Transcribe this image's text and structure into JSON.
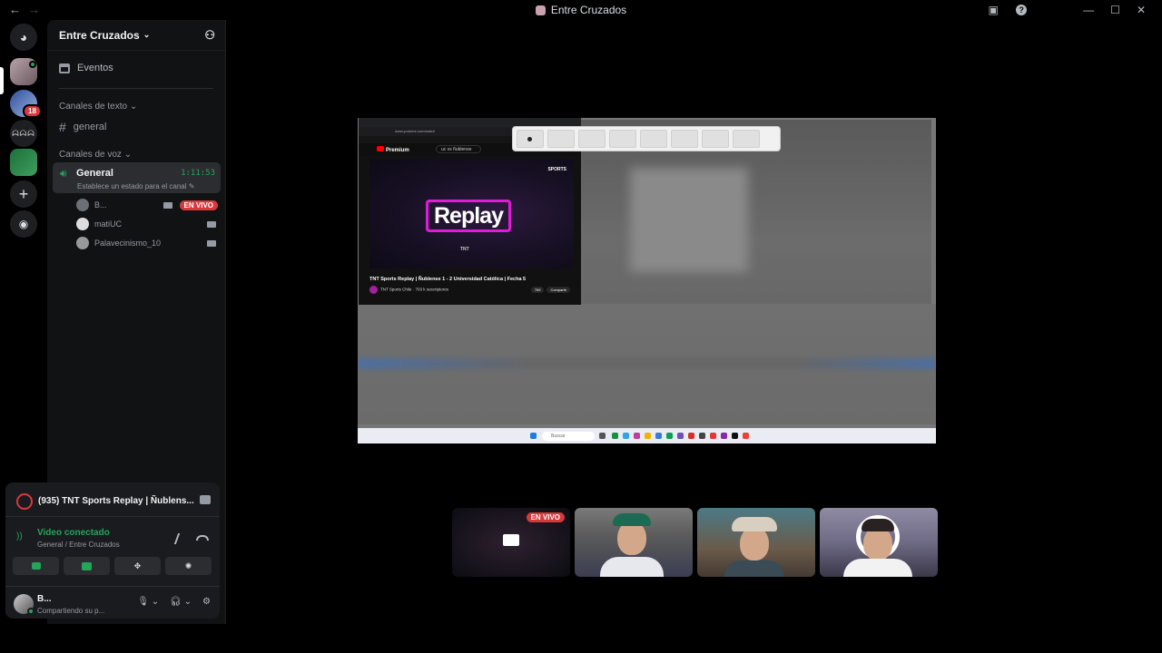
{
  "window": {
    "title": "Entre Cruzados",
    "back_icon": "←",
    "forward_icon": "→",
    "minimize": "—",
    "maximize": "☐",
    "close": "✕"
  },
  "guilds": {
    "badge": "18",
    "g3_label": "ᗣᗣᗣ"
  },
  "server": {
    "name": "Entre Cruzados",
    "events_label": "Eventos",
    "text_category": "Canales de texto",
    "text_channels": [
      {
        "name": "general"
      }
    ],
    "voice_category": "Canales de voz",
    "voice_channel": {
      "name": "General",
      "timer": "1:11:53",
      "status_placeholder": "Establece un estado para el canal"
    },
    "voice_users": [
      {
        "name": "B...",
        "live_label": "EN VIVO"
      },
      {
        "name": "matiUC"
      },
      {
        "name": "Palavecinismo_10"
      }
    ]
  },
  "stream_panel": {
    "title": "(935) TNT Sports Replay | Ñublens..."
  },
  "rtc": {
    "status": "Video conectado",
    "location": "General / Entre Cruzados"
  },
  "user": {
    "name": "B...",
    "status": "Compartiendo su p..."
  },
  "screen_share": {
    "youtube": {
      "brand": "Premium",
      "search": "uc vs ñublense",
      "replay_text": "Replay",
      "sports_text": "SPORTS",
      "tnt_text": "TNT",
      "video_title": "TNT Sports Replay | Ñublense 1 - 2 Universidad Católica | Fecha 5",
      "channel": "TNT Sports Chile",
      "subscribers": "703 k suscriptores",
      "likes": "769",
      "share": "Compartir",
      "url": "www.youtube.com/watch"
    },
    "taskbar_search": "Buscar"
  },
  "tiles": {
    "live_label": "EN VIVO"
  },
  "colors": {
    "accent_green": "#23a55a",
    "live_red": "#da373c",
    "replay_magenta": "#e21bdb"
  }
}
